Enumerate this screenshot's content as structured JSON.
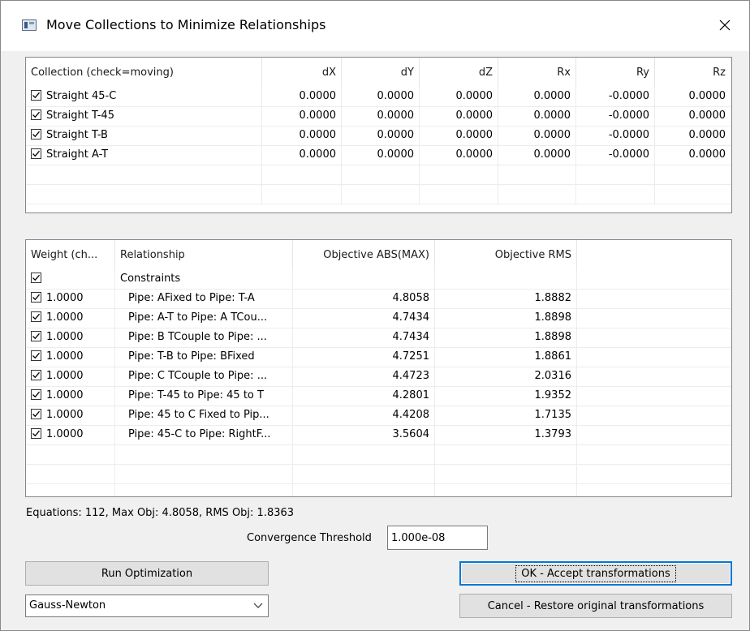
{
  "window": {
    "title": "Move Collections to Minimize Relationships",
    "close_icon": "close-icon"
  },
  "collections": {
    "headers": [
      "Collection (check=moving)",
      "dX",
      "dY",
      "dZ",
      "Rx",
      "Ry",
      "Rz"
    ],
    "rows": [
      {
        "checked": true,
        "name": "Straight 45-C",
        "dX": "0.0000",
        "dY": "0.0000",
        "dZ": "0.0000",
        "Rx": "0.0000",
        "Ry": "-0.0000",
        "Rz": "0.0000"
      },
      {
        "checked": true,
        "name": "Straight T-45",
        "dX": "0.0000",
        "dY": "0.0000",
        "dZ": "0.0000",
        "Rx": "0.0000",
        "Ry": "-0.0000",
        "Rz": "0.0000"
      },
      {
        "checked": true,
        "name": "Straight T-B",
        "dX": "0.0000",
        "dY": "0.0000",
        "dZ": "0.0000",
        "Rx": "0.0000",
        "Ry": "-0.0000",
        "Rz": "0.0000"
      },
      {
        "checked": true,
        "name": "Straight A-T",
        "dX": "0.0000",
        "dY": "0.0000",
        "dZ": "0.0000",
        "Rx": "0.0000",
        "Ry": "-0.0000",
        "Rz": "0.0000"
      }
    ]
  },
  "relationships": {
    "headers": [
      "Weight (ch...",
      "Relationship",
      "Objective ABS(MAX)",
      "Objective RMS",
      ""
    ],
    "group": {
      "checked": true,
      "label": "Constraints"
    },
    "rows": [
      {
        "checked": true,
        "weight": "1.0000",
        "name": "Pipe: AFixed to Pipe: T-A",
        "abs": "4.8058",
        "rms": "1.8882"
      },
      {
        "checked": true,
        "weight": "1.0000",
        "name": "Pipe: A-T to Pipe: A TCou...",
        "abs": "4.7434",
        "rms": "1.8898"
      },
      {
        "checked": true,
        "weight": "1.0000",
        "name": "Pipe: B TCouple to Pipe: ...",
        "abs": "4.7434",
        "rms": "1.8898"
      },
      {
        "checked": true,
        "weight": "1.0000",
        "name": "Pipe: T-B to Pipe: BFixed",
        "abs": "4.7251",
        "rms": "1.8861"
      },
      {
        "checked": true,
        "weight": "1.0000",
        "name": "Pipe: C TCouple to Pipe: ...",
        "abs": "4.4723",
        "rms": "2.0316"
      },
      {
        "checked": true,
        "weight": "1.0000",
        "name": "Pipe: T-45 to Pipe: 45 to T",
        "abs": "4.2801",
        "rms": "1.9352"
      },
      {
        "checked": true,
        "weight": "1.0000",
        "name": "Pipe: 45 to C Fixed to Pip...",
        "abs": "4.4208",
        "rms": "1.7135"
      },
      {
        "checked": true,
        "weight": "1.0000",
        "name": "Pipe: 45-C to Pipe: RightF...",
        "abs": "3.5604",
        "rms": "1.3793"
      }
    ]
  },
  "status": {
    "summary": "Equations: 112, Max Obj: 4.8058, RMS Obj: 1.8363"
  },
  "convergence": {
    "label": "Convergence Threshold",
    "value": "1.000e-08"
  },
  "buttons": {
    "run": "Run Optimization",
    "ok": "OK - Accept transformations",
    "cancel": "Cancel - Restore original transformations"
  },
  "method": {
    "selected": "Gauss-Newton"
  }
}
